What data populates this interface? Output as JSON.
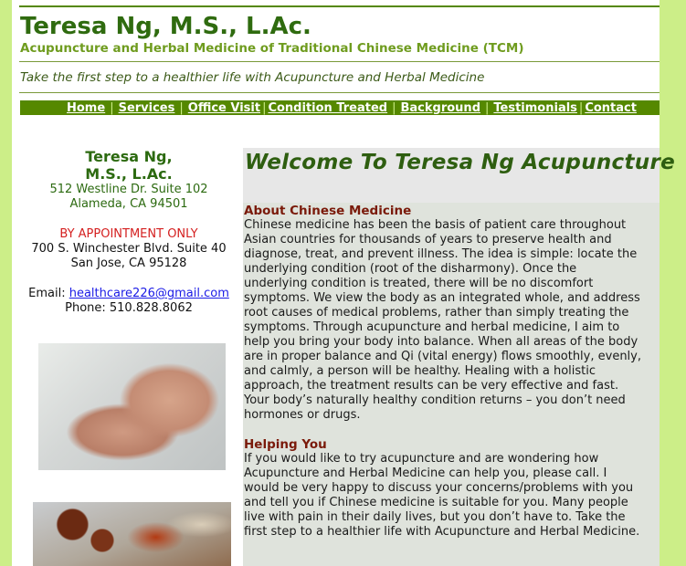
{
  "header": {
    "title": "Teresa Ng, M.S., L.Ac.",
    "subtitle": "Acupuncture and Herbal Medicine of Traditional Chinese Medicine (TCM)",
    "tagline": "Take the first step to a healthier life with Acupuncture and Herbal Medicine"
  },
  "nav": {
    "items": [
      "Home",
      "Services",
      "Office Visit",
      "Condition Treated",
      "Background",
      "Testimonials",
      "Contact"
    ]
  },
  "sidebar": {
    "name_line1": "Teresa Ng,",
    "name_line2": "M.S., L.Ac.",
    "address1_line1": "512 Westline Dr. Suite 102",
    "address1_line2": "Alameda, CA 94501",
    "appointment": "BY APPOINTMENT ONLY",
    "address2_line1": "700 S. Winchester Blvd. Suite 40",
    "address2_line2": "San Jose, CA 95128",
    "email_label": "Email:",
    "email": "healthcare226@gmail.com",
    "phone": "Phone: 510.828.8062"
  },
  "main": {
    "welcome": "Welcome To Teresa Ng Acupuncture",
    "about_heading": "About Chinese Medicine",
    "about_lines": [
      "Chinese medicine has been the basis of patient care throughout",
      "Asian countries for thousands of years to preserve health and",
      "diagnose, treat, and prevent illness.  The idea is simple: locate the",
      "underlying condition (root of the disharmony).  Once the",
      "underlying condition is treated, there will be no discomfort",
      "symptoms.  We view the body as an integrated whole, and address",
      "root causes of medical problems, rather than simply treating the",
      "symptoms.  Through acupuncture and herbal medicine, I aim to",
      "help you bring your body into balance. When all areas of the body",
      "are in proper balance and Qi (vital energy) flows smoothly, evenly,",
      "and calmly, a person will be healthy.  Healing with a holistic",
      "approach, the treatment results can be very effective and fast.",
      " Your body’s naturally healthy condition returns – you don’t need",
      "hormones or drugs."
    ],
    "helping_heading": "Helping You",
    "helping_lines": [
      "If you would like to try acupuncture and are wondering how",
      "Acupuncture and Herbal Medicine can help you, please call.  I",
      "would be very happy to discuss your concerns/problems with you",
      "and tell you if Chinese medicine is suitable for you.  Many people",
      "live with pain in their daily lives, but you don’t have to.  Take the",
      "first step to a healthier life with Acupuncture and Herbal Medicine."
    ]
  }
}
